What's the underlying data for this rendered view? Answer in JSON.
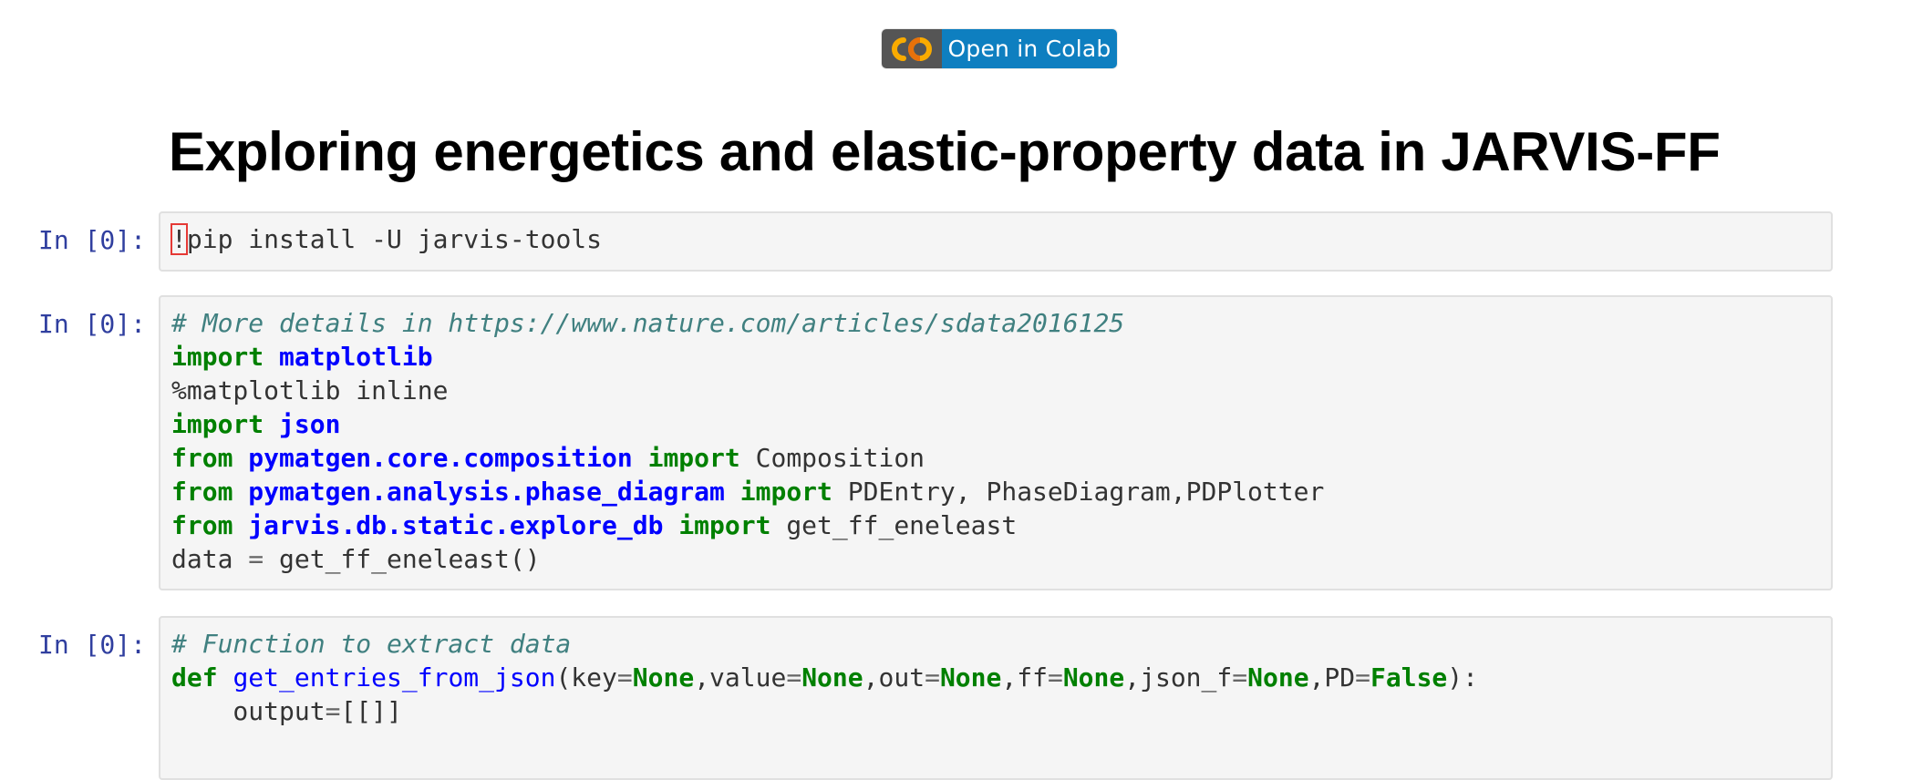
{
  "badge": {
    "label": "Open in Colab",
    "logo_icon": "colab-logo-icon",
    "colors": {
      "logo_bg": "#555555",
      "label_bg": "#0e7fc0",
      "logo_orange": "#f9ab00"
    }
  },
  "title": "Exploring energetics and elastic-property data in JARVIS-FF",
  "cells": [
    {
      "prompt": "In [0]:",
      "lines": [
        [
          {
            "t": "err",
            "v": "!"
          },
          {
            "t": "plain",
            "v": "pip install -U jarvis-tools"
          }
        ]
      ]
    },
    {
      "prompt": "In [0]:",
      "lines": [
        [
          {
            "t": "c1",
            "v": "# More details in https://www.nature.com/articles/sdata2016125"
          }
        ],
        [
          {
            "t": "kw",
            "v": "import"
          },
          {
            "t": "plain",
            "v": " "
          },
          {
            "t": "nn",
            "v": "matplotlib"
          }
        ],
        [
          {
            "t": "plain",
            "v": "%matplotlib inline"
          }
        ],
        [
          {
            "t": "kw",
            "v": "import"
          },
          {
            "t": "plain",
            "v": " "
          },
          {
            "t": "nn",
            "v": "json"
          }
        ],
        [
          {
            "t": "kw",
            "v": "from"
          },
          {
            "t": "plain",
            "v": " "
          },
          {
            "t": "nn",
            "v": "pymatgen.core.composition"
          },
          {
            "t": "plain",
            "v": " "
          },
          {
            "t": "kw",
            "v": "import"
          },
          {
            "t": "plain",
            "v": " Composition"
          }
        ],
        [
          {
            "t": "kw",
            "v": "from"
          },
          {
            "t": "plain",
            "v": " "
          },
          {
            "t": "nn",
            "v": "pymatgen.analysis.phase_diagram"
          },
          {
            "t": "plain",
            "v": " "
          },
          {
            "t": "kw",
            "v": "import"
          },
          {
            "t": "plain",
            "v": " PDEntry, PhaseDiagram,PDPlotter"
          }
        ],
        [
          {
            "t": "kw",
            "v": "from"
          },
          {
            "t": "plain",
            "v": " "
          },
          {
            "t": "nn",
            "v": "jarvis.db.static.explore_db"
          },
          {
            "t": "plain",
            "v": " "
          },
          {
            "t": "kw",
            "v": "import"
          },
          {
            "t": "plain",
            "v": " get_ff_eneleast"
          }
        ],
        [
          {
            "t": "plain",
            "v": "data "
          },
          {
            "t": "op",
            "v": "="
          },
          {
            "t": "plain",
            "v": " get_ff_eneleast()"
          }
        ]
      ]
    },
    {
      "prompt": "In [0]:",
      "lines": [
        [
          {
            "t": "c1",
            "v": "# Function to extract data"
          }
        ],
        [
          {
            "t": "kw",
            "v": "def"
          },
          {
            "t": "plain",
            "v": " "
          },
          {
            "t": "nf",
            "v": "get_entries_from_json"
          },
          {
            "t": "plain",
            "v": "(key"
          },
          {
            "t": "op",
            "v": "="
          },
          {
            "t": "kw",
            "v": "None"
          },
          {
            "t": "plain",
            "v": ",value"
          },
          {
            "t": "op",
            "v": "="
          },
          {
            "t": "kw",
            "v": "None"
          },
          {
            "t": "plain",
            "v": ",out"
          },
          {
            "t": "op",
            "v": "="
          },
          {
            "t": "kw",
            "v": "None"
          },
          {
            "t": "plain",
            "v": ",ff"
          },
          {
            "t": "op",
            "v": "="
          },
          {
            "t": "kw",
            "v": "None"
          },
          {
            "t": "plain",
            "v": ",json_f"
          },
          {
            "t": "op",
            "v": "="
          },
          {
            "t": "kw",
            "v": "None"
          },
          {
            "t": "plain",
            "v": ",PD"
          },
          {
            "t": "op",
            "v": "="
          },
          {
            "t": "kw",
            "v": "False"
          },
          {
            "t": "plain",
            "v": "):"
          }
        ],
        [
          {
            "t": "plain",
            "v": "    output"
          },
          {
            "t": "op",
            "v": "="
          },
          {
            "t": "plain",
            "v": "[[]]"
          }
        ]
      ]
    }
  ]
}
